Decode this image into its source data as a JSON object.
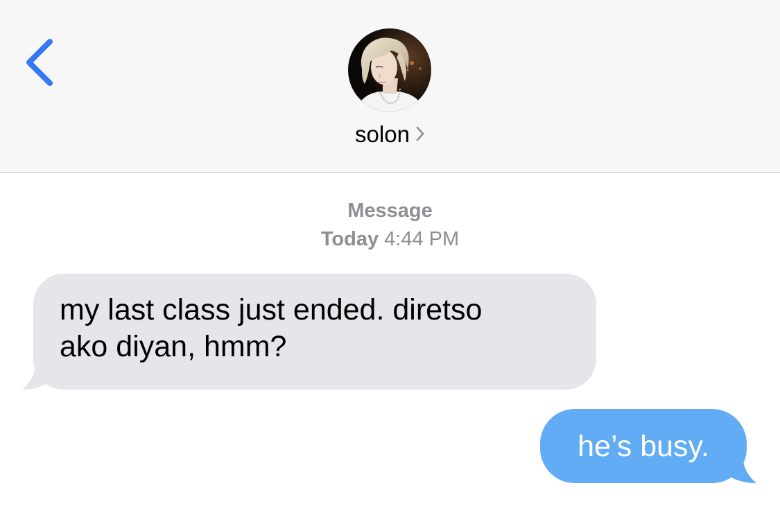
{
  "header": {
    "back_icon": "chevron-left-icon",
    "avatar_icon": "contact-avatar",
    "contact_name": "solon",
    "contact_chevron_icon": "chevron-right-icon"
  },
  "conversation": {
    "service_label": "Message",
    "timestamp_day": "Today",
    "timestamp_time": "4:44 PM",
    "messages": [
      {
        "direction": "incoming",
        "text_line1": "my last class just ended. diretso",
        "text_line2": "ako diyan, hmm?"
      },
      {
        "direction": "outgoing",
        "text": "he’s busy."
      }
    ]
  },
  "colors": {
    "accent_blue": "#3478f6",
    "incoming_bubble": "#e5e5ea",
    "outgoing_bubble": "#62abf5",
    "nav_background": "#f7f7f7",
    "secondary_text": "#8e8e93"
  }
}
